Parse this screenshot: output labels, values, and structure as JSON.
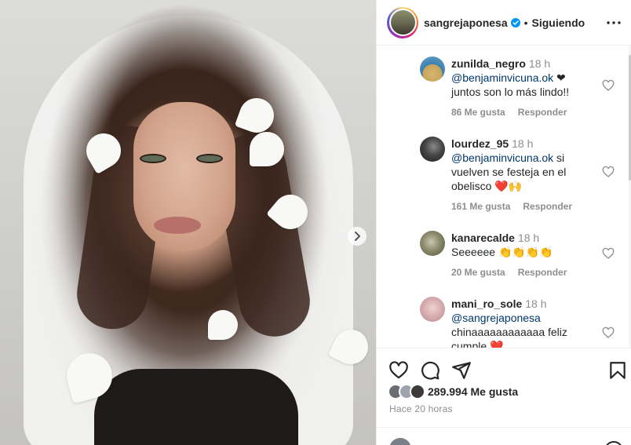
{
  "post": {
    "username": "sangrejaponesa",
    "separator": "•",
    "follow_status": "Siguiendo",
    "likes": "289.994 Me gusta",
    "time_ago": "Hace 20 horas"
  },
  "comments": [
    {
      "username": "zunilda_negro",
      "time": "18 h",
      "mention": "@benjaminvicuna.ok",
      "text": " ❤ juntos son lo más lindo!!",
      "likes": "86 Me gusta",
      "reply": "Responder"
    },
    {
      "username": "lourdez_95",
      "time": "18 h",
      "mention": "@benjaminvicuna.ok",
      "text": " si vuelven se festeja en el obelisco ❤️🙌",
      "likes": "161 Me gusta",
      "reply": "Responder"
    },
    {
      "username": "kanarecalde",
      "time": "18 h",
      "mention": "",
      "text": "Seeeeee 👏👏👏👏",
      "likes": "20 Me gusta",
      "reply": "Responder"
    },
    {
      "username": "mani_ro_sole",
      "time": "18 h",
      "mention": "@sangrejaponesa",
      "text": " chinaaaaaaaaaaaa feliz cumple ❤️",
      "likes": "",
      "reply": ""
    }
  ],
  "colors": {
    "text": "#262626",
    "secondary": "#8e8e8e",
    "mention": "#00376b",
    "verified": "#0095f6",
    "border": "#efefef"
  },
  "icons": [
    "chevron-right-icon",
    "verified-badge-icon",
    "more-options-icon",
    "heart-icon",
    "comment-icon",
    "share-icon",
    "bookmark-icon",
    "emoji-icon"
  ]
}
